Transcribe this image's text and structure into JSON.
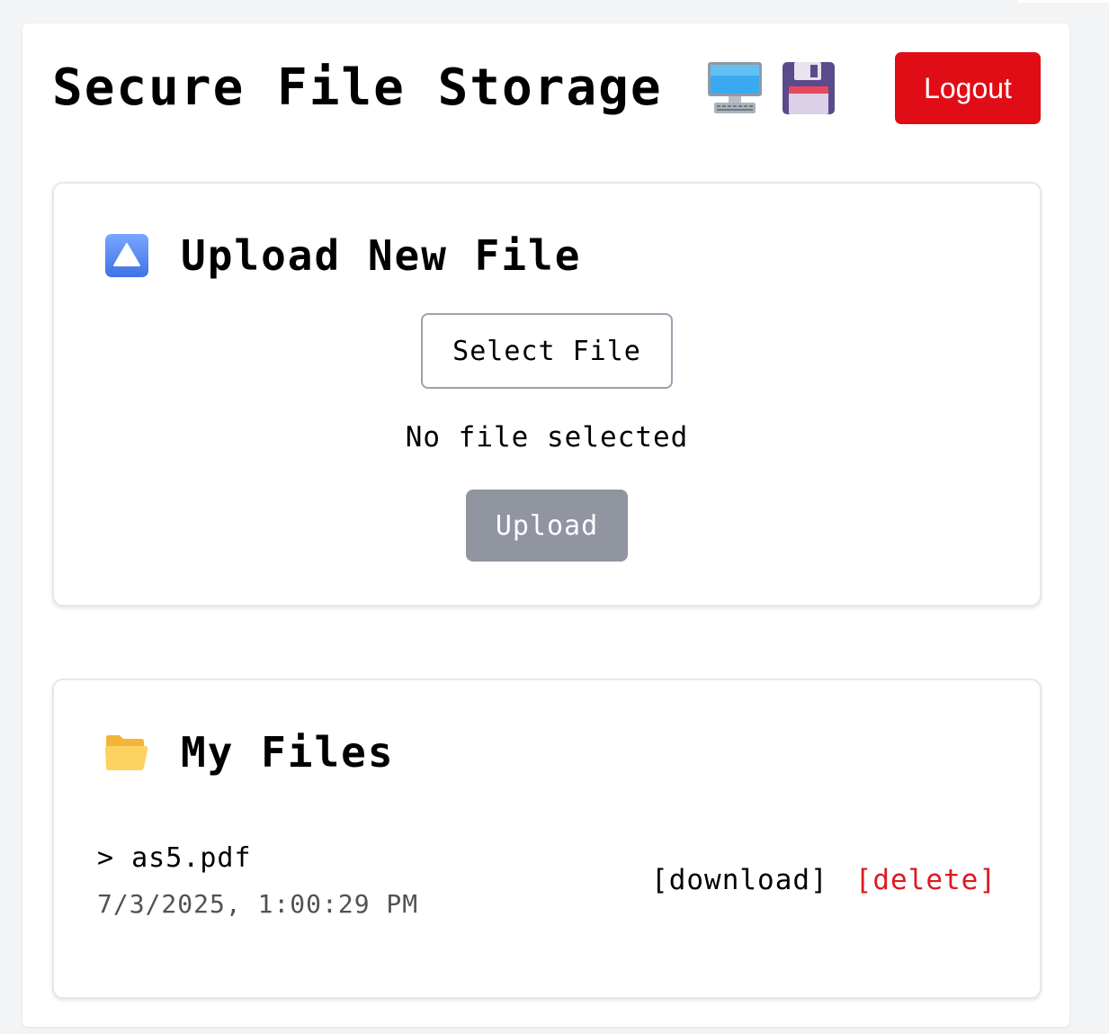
{
  "header": {
    "title": "Secure File Storage",
    "icons": [
      "desktop-computer-icon",
      "floppy-disk-icon"
    ],
    "logout_label": "Logout"
  },
  "upload": {
    "heading": "Upload New File",
    "heading_icon": "up-arrow-button-icon",
    "select_label": "Select File",
    "status_text": "No file selected",
    "upload_label": "Upload"
  },
  "files": {
    "heading": "My Files",
    "heading_icon": "open-folder-icon",
    "items": [
      {
        "name": "> as5.pdf",
        "date": "7/3/2025, 1:00:29 PM",
        "download_label": "[download]",
        "delete_label": "[delete]"
      }
    ]
  },
  "colors": {
    "page_background": "#f3f4f6",
    "logout_button": "#e00d17",
    "upload_button_disabled": "#9195a0",
    "delete_link": "#dc1a22"
  }
}
